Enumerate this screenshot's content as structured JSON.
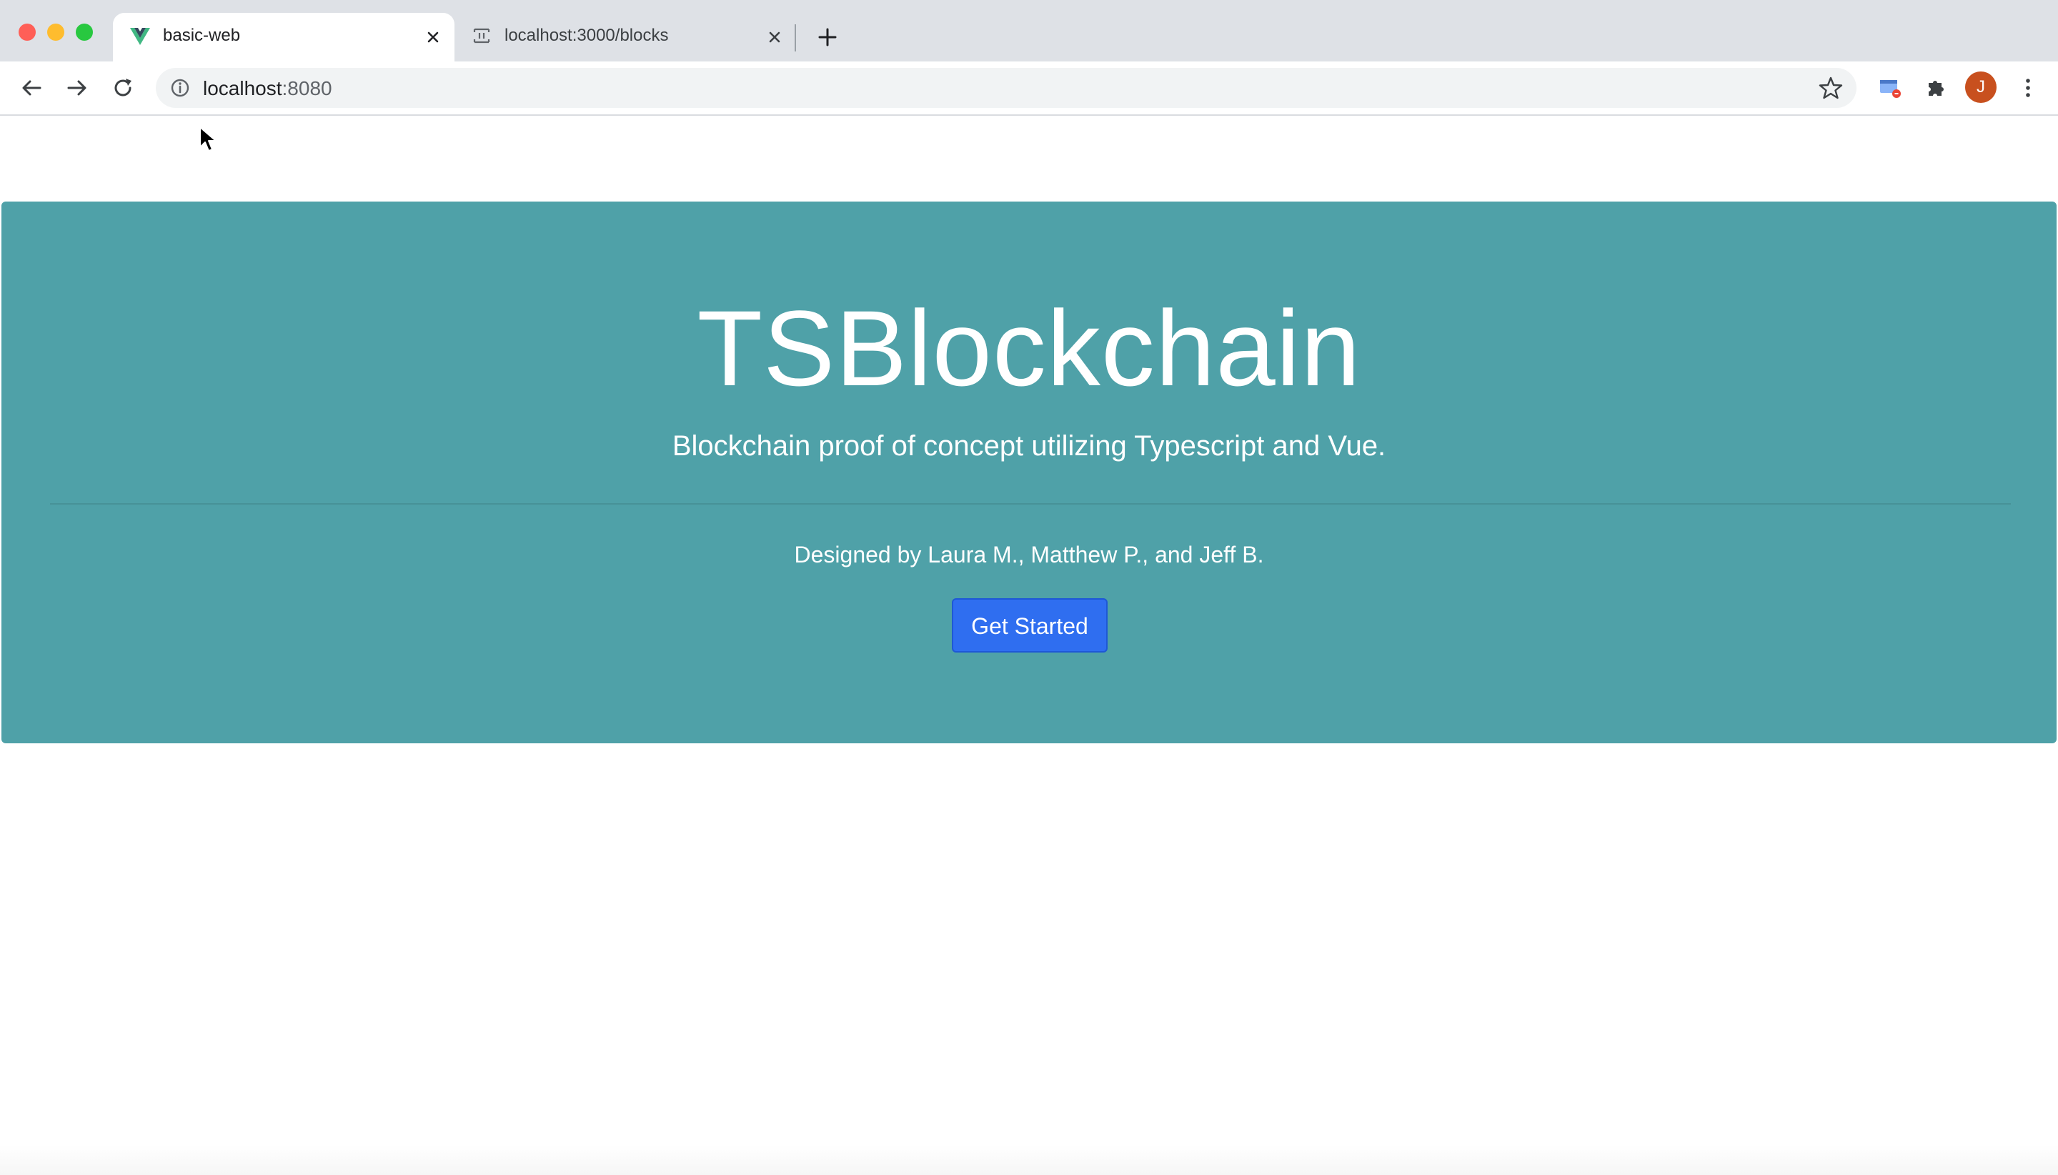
{
  "window": {
    "traffic_lights": {
      "close_color": "#ff5f57",
      "minimize_color": "#febc2e",
      "maximize_color": "#28c840"
    }
  },
  "tabs": [
    {
      "title": "basic-web",
      "favicon": "vue-logo-icon",
      "active": true
    },
    {
      "title": "localhost:3000/blocks",
      "favicon": "document-icon",
      "active": false
    }
  ],
  "toolbar": {
    "url_host": "localhost",
    "url_port": ":8080",
    "avatar_letter": "J",
    "avatar_color": "#c8501e"
  },
  "hero": {
    "title": "TSBlockchain",
    "subtitle": "Blockchain proof of concept utilizing Typescript and Vue.",
    "designed_by": "Designed by Laura M., Matthew P., and Jeff B.",
    "button_label": "Get Started",
    "background_color": "#4fa1a8",
    "button_color": "#2f6ef0"
  }
}
